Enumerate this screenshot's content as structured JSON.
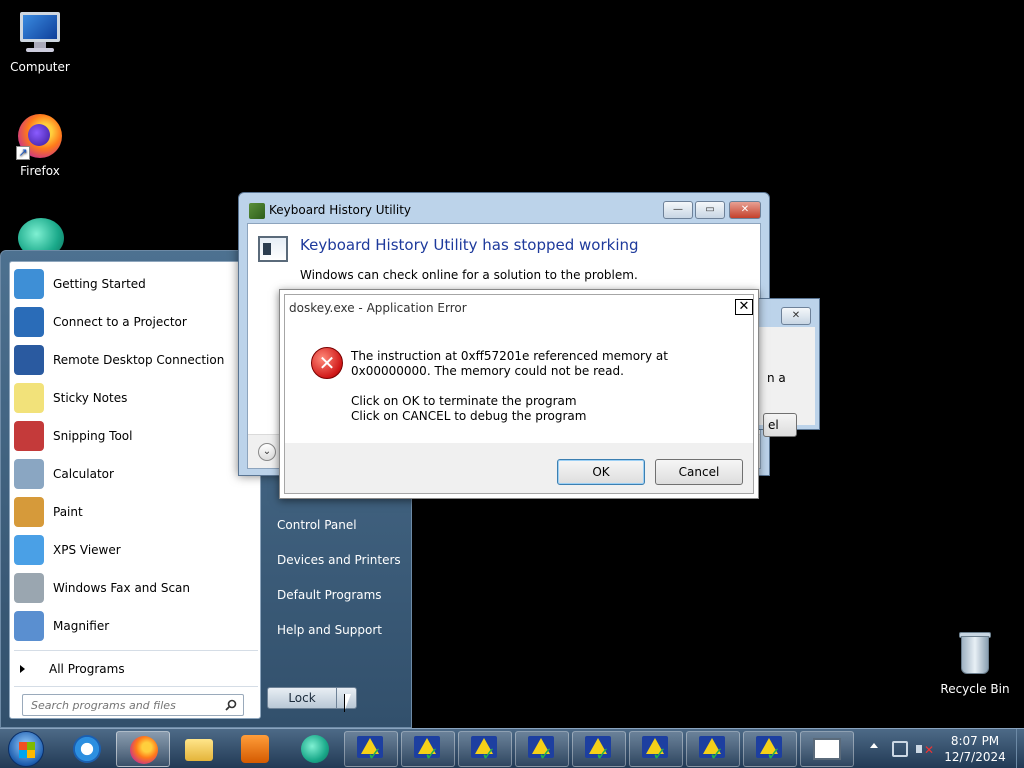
{
  "desktop": {
    "icons": [
      {
        "label": "Computer"
      },
      {
        "label": "Firefox"
      },
      {
        "label": ""
      },
      {
        "label": "Recycle Bin"
      }
    ]
  },
  "start_menu": {
    "programs": [
      {
        "label": "Getting Started",
        "icon": "getting-started-icon",
        "color": "#3e8fd6"
      },
      {
        "label": "Connect to a Projector",
        "icon": "projector-icon",
        "color": "#2a6cb8"
      },
      {
        "label": "Remote Desktop Connection",
        "icon": "remote-desktop-icon",
        "color": "#2a5aa0"
      },
      {
        "label": "Sticky Notes",
        "icon": "sticky-notes-icon",
        "color": "#f2e27a"
      },
      {
        "label": "Snipping Tool",
        "icon": "scissors-icon",
        "color": "#c43a3a"
      },
      {
        "label": "Calculator",
        "icon": "calculator-icon",
        "color": "#8aa6c2"
      },
      {
        "label": "Paint",
        "icon": "paint-icon",
        "color": "#d69a3a"
      },
      {
        "label": "XPS Viewer",
        "icon": "xps-viewer-icon",
        "color": "#4aa0e6"
      },
      {
        "label": "Windows Fax and Scan",
        "icon": "fax-icon",
        "color": "#9aa6b0"
      },
      {
        "label": "Magnifier",
        "icon": "magnifier-icon",
        "color": "#5a8fd0"
      }
    ],
    "all_programs": "All Programs",
    "search_placeholder": "Search programs and files",
    "right_items": [
      "Control Panel",
      "Devices and Printers",
      "Default Programs",
      "Help and Support"
    ],
    "lock_label": "Lock"
  },
  "khu_window": {
    "title": "Keyboard History Utility",
    "heading": "Keyboard History Utility has stopped working",
    "subtext": "Windows can check online for a solution to the problem."
  },
  "partial_dialog": {
    "text_fragment": "n a",
    "button_fragment": "el"
  },
  "error_dialog": {
    "title": "doskey.exe - Application Error",
    "message_line1": "The instruction at 0xff57201e referenced memory at 0x00000000. The memory could not be read.",
    "message_line2": "Click on OK to terminate the program",
    "message_line3": "Click on CANCEL to debug the program",
    "ok_label": "OK",
    "cancel_label": "Cancel"
  },
  "taskbar": {
    "pinned": [
      "internet-explorer-icon",
      "firefox-icon",
      "folder-icon",
      "media-player-icon",
      "app-icon"
    ],
    "task_buttons_count": 8,
    "clock_time": "8:07 PM",
    "clock_date": "12/7/2024"
  }
}
